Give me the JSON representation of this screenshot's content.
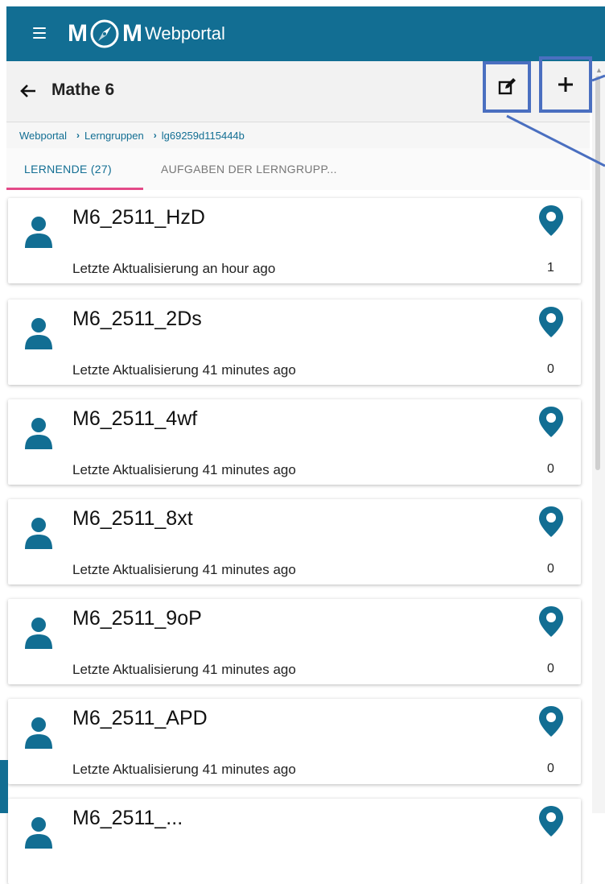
{
  "app": {
    "brand_mark_left": "M",
    "brand_mark_right": "M",
    "brand_text": "Webportal"
  },
  "header": {
    "title": "Mathe 6"
  },
  "breadcrumb": {
    "items": [
      "Webportal",
      "Lerngruppen",
      "lg69259d115444b"
    ]
  },
  "tabs": [
    {
      "label": "LERNENDE (27)",
      "active": true
    },
    {
      "label": "AUFGABEN DER LERNGRUPP..."
    }
  ],
  "learners": [
    {
      "name": "M6_2511_HzD",
      "updated": "Letzte Aktualisierung an hour ago",
      "count": "1"
    },
    {
      "name": "M6_2511_2Ds",
      "updated": "Letzte Aktualisierung 41 minutes ago",
      "count": "0"
    },
    {
      "name": "M6_2511_4wf",
      "updated": "Letzte Aktualisierung 41 minutes ago",
      "count": "0"
    },
    {
      "name": "M6_2511_8xt",
      "updated": "Letzte Aktualisierung 41 minutes ago",
      "count": "0"
    },
    {
      "name": "M6_2511_9oP",
      "updated": "Letzte Aktualisierung 41 minutes ago",
      "count": "0"
    },
    {
      "name": "M6_2511_APD",
      "updated": "Letzte Aktualisierung 41 minutes ago",
      "count": "0"
    },
    {
      "name": "M6_2511_...",
      "updated": "",
      "count": ""
    }
  ],
  "icons": {
    "menu": "hamburger-menu-icon",
    "back": "arrow-left-icon",
    "edit": "edit-icon",
    "add": "plus-icon",
    "avatar": "person-icon",
    "location": "map-pin-icon"
  },
  "colors": {
    "brand": "#126e93",
    "tab_indicator": "#e34a88",
    "annotation": "#4a6fc0"
  }
}
